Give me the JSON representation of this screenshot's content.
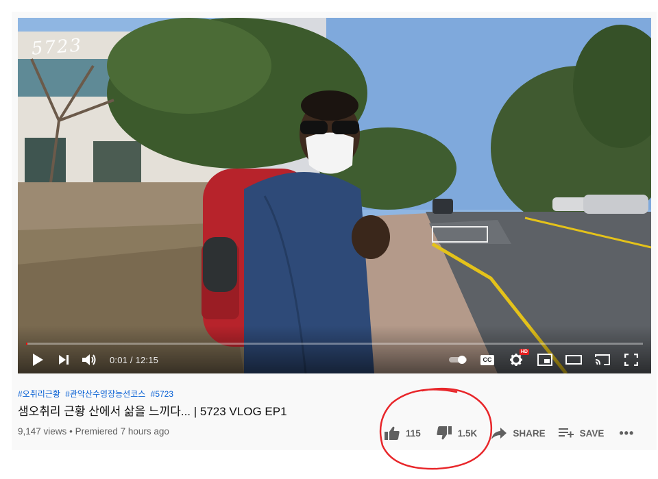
{
  "player": {
    "watermark": "5723",
    "time_current": "0:01",
    "time_separator": "/",
    "time_total": "12:15",
    "progress": 0.002,
    "controls": {
      "play_icon": "play-icon",
      "next_icon": "next-icon",
      "volume_icon": "volume-icon",
      "autoplay_icon": "autoplay-toggle-icon",
      "cc_label": "CC",
      "settings_badge": "HD",
      "miniplayer_icon": "miniplayer-icon",
      "theater_icon": "theater-icon",
      "cast_icon": "cast-icon",
      "fullscreen_icon": "fullscreen-icon"
    }
  },
  "info": {
    "hashtags": [
      "#오취리근황",
      "#관악산수영장능선코스",
      "#5723"
    ],
    "title": "샘오취리 근황 산에서 삶을 느끼다... | 5723 VLOG EP1",
    "views": "9,147 views",
    "separator": "•",
    "premiered": "Premiered 7 hours ago"
  },
  "actions": {
    "like_count": "115",
    "dislike_count": "1.5K",
    "share_label": "SHARE",
    "save_label": "SAVE",
    "more_label": "•••"
  },
  "colors": {
    "hashtag": "#065fd4",
    "progress": "#ff0000",
    "annotation": "#e8262a",
    "meta_text": "#606060"
  }
}
